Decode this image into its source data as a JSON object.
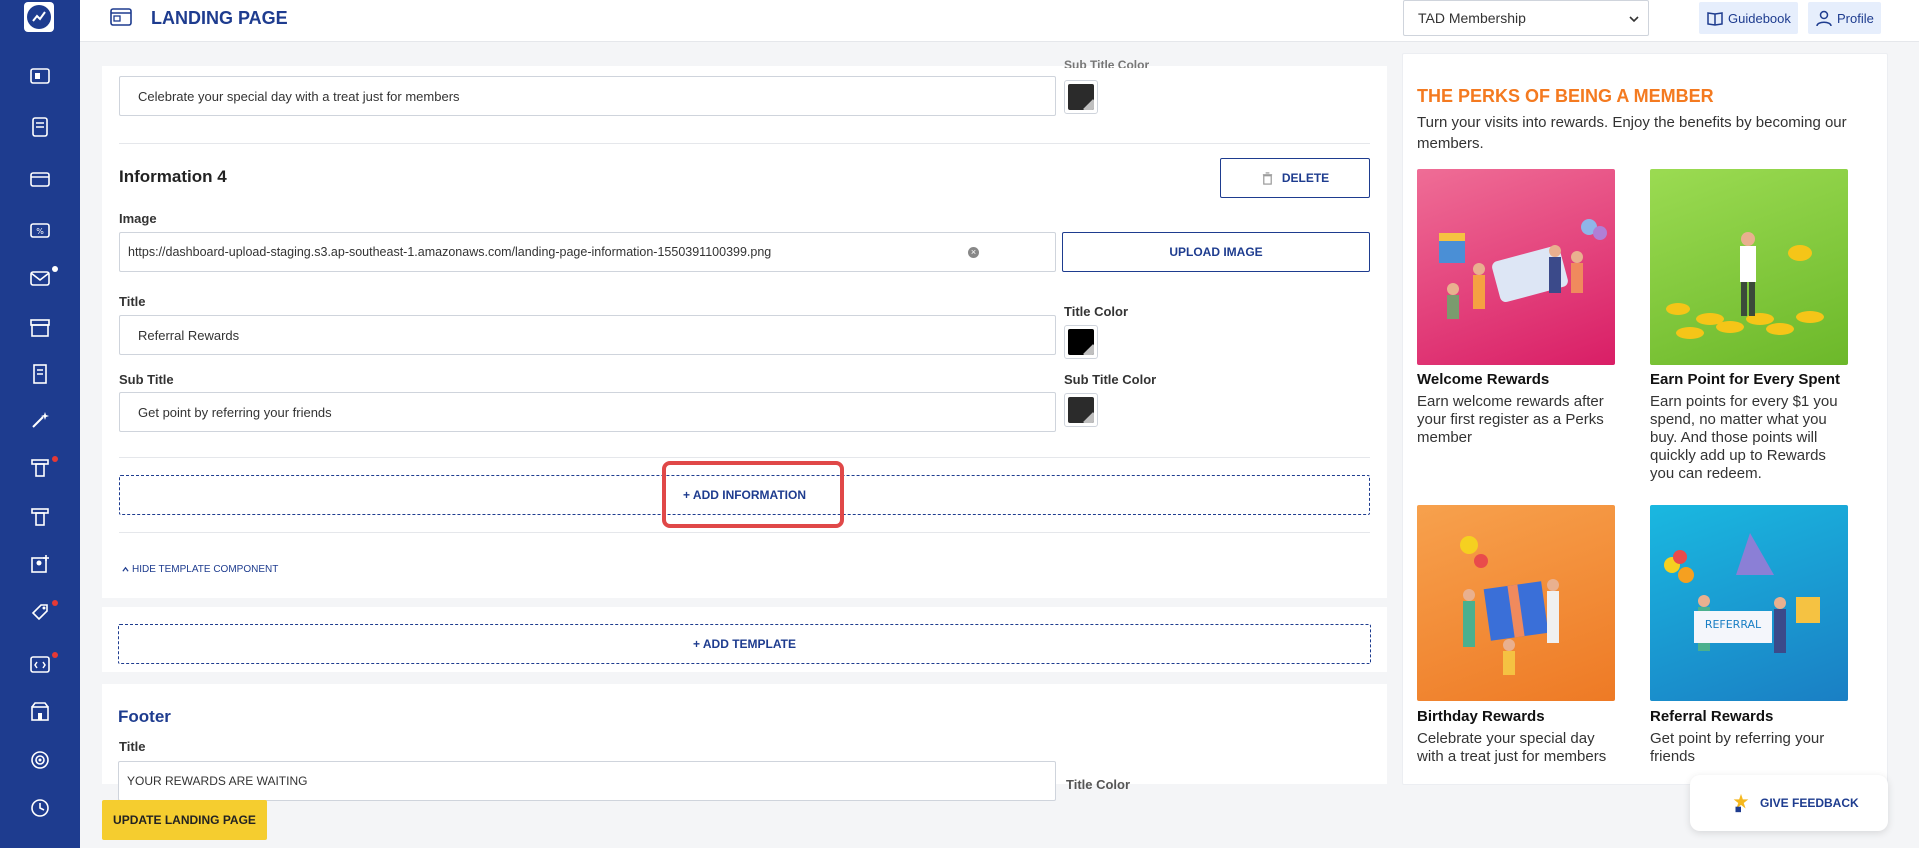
{
  "header": {
    "title": "LANDING PAGE",
    "membership_select": "TAD Membership",
    "guidebook_label": "Guidebook",
    "profile_label": "Profile"
  },
  "colors": {
    "brand": "#1e3c8f",
    "accent": "#f47a20",
    "highlight": "#e04848",
    "update_button": "#f5cd2f"
  },
  "form": {
    "prev_subtitle_label": "Sub Title Color",
    "prev_subtitle_value": "Celebrate your special day with a treat just for members",
    "section_heading": "Information 4",
    "delete_label": "DELETE",
    "image_label": "Image",
    "image_url": "https://dashboard-upload-staging.s3.ap-southeast-1.amazonaws.com/landing-page-information-1550391100399.png",
    "upload_label": "UPLOAD IMAGE",
    "title_label": "Title",
    "title_value": "Referral Rewards",
    "title_color_label": "Title Color",
    "subtitle_label": "Sub Title",
    "subtitle_value": "Get point by referring your friends",
    "subtitle_color_label": "Sub Title Color",
    "add_information_label": "+ ADD INFORMATION",
    "hide_template_label": "HIDE TEMPLATE COMPONENT",
    "add_template_label": "+ ADD TEMPLATE",
    "footer_heading": "Footer",
    "footer_title_label": "Title",
    "footer_title_value": "YOUR REWARDS ARE WAITING",
    "footer_title_color_label": "Title Color"
  },
  "update_button": "UPDATE LANDING PAGE",
  "preview": {
    "title": "THE PERKS OF BEING A MEMBER",
    "subtitle": "Turn your visits into rewards. Enjoy the benefits by becoming our members.",
    "perks": [
      {
        "title": "Welcome Rewards",
        "description": "Earn welcome rewards after your first register as a Perks member",
        "image": "gift-card-people-illustration"
      },
      {
        "title": "Earn Point for Every Spent",
        "description": "Earn points for every $1 you spend, no matter what you buy. And those points will quickly add up to Rewards you can redeem.",
        "image": "coins-person-illustration"
      },
      {
        "title": "Birthday Rewards",
        "description": "Celebrate your special day with a treat just for members",
        "image": "birthday-gift-illustration"
      },
      {
        "title": "Referral Rewards",
        "description": "Get point by referring your friends",
        "image": "referral-banner-illustration",
        "banner_text": "REFERRAL"
      }
    ]
  },
  "feedback_label": "GIVE FEEDBACK",
  "sidebar": {
    "icons": [
      "dashboard-icon",
      "document-icon",
      "card-icon",
      "discount-icon",
      "mail-icon",
      "store-icon",
      "receipt-icon",
      "magic-wand-icon",
      "template-icon",
      "template-alt-icon",
      "user-add-icon",
      "tag-icon",
      "code-icon",
      "shop-icon",
      "target-icon",
      "history-icon"
    ]
  }
}
